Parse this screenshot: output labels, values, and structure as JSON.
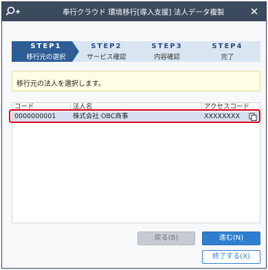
{
  "window": {
    "title": "奉行クラウド 環境移行[導入支援] 法人データ複製",
    "close_glyph": "✕"
  },
  "steps": [
    {
      "num": "STEP1",
      "label": "移行元の選択",
      "state": "active"
    },
    {
      "num": "STEP2",
      "label": "サービス確認",
      "state": "inactive"
    },
    {
      "num": "STEP3",
      "label": "内容確認",
      "state": "inactive"
    },
    {
      "num": "STEP4",
      "label": "完了",
      "state": "inactive"
    }
  ],
  "info": {
    "message": "移行元の法人を選択します。"
  },
  "table": {
    "columns": [
      "コード",
      "法人名",
      "アクセスコード"
    ],
    "rows": [
      {
        "code": "0000000001",
        "name": "株式会社 OBC商事",
        "access_code": "XXXXXXXX"
      }
    ]
  },
  "buttons": {
    "back": "戻る(B)",
    "next": "進む(N)",
    "end": "終了する(X)"
  },
  "colors": {
    "titlebar": "#3b4a5c",
    "step_active": "#2e5d96",
    "step_inactive": "#d9e6f2",
    "primary": "#2f7fd0",
    "highlight": "#e0001b"
  },
  "icons": {
    "app": "search-plus-icon",
    "close": "close-icon",
    "copy": "copy-icon"
  }
}
